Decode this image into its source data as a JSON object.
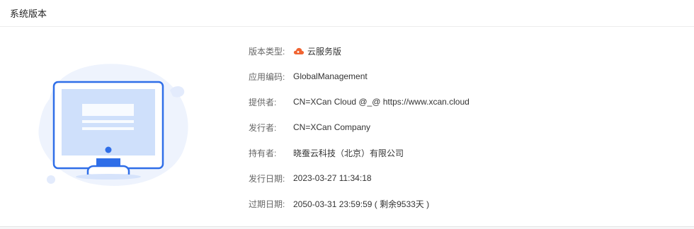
{
  "header": {
    "title": "系统版本"
  },
  "info": {
    "rows": [
      {
        "label": "版本类型:",
        "value": "云服务版",
        "icon": "cloud-icon"
      },
      {
        "label": "应用编码:",
        "value": "GlobalManagement"
      },
      {
        "label": "提供者:",
        "value": "CN=XCan Cloud @_@ https://www.xcan.cloud"
      },
      {
        "label": "发行者:",
        "value": "CN=XCan Company"
      },
      {
        "label": "持有者:",
        "value": "晓蚕云科技（北京）有限公司"
      },
      {
        "label": "发行日期:",
        "value": "2023-03-27 11:34:18"
      },
      {
        "label": "过期日期:",
        "value": "2050-03-31 23:59:59 ( 剩余9533天 )"
      }
    ]
  },
  "colors": {
    "accent_blue": "#2f6ee8",
    "cloud_icon": "#f06432",
    "illustration_bg": "#e8f0ff"
  }
}
